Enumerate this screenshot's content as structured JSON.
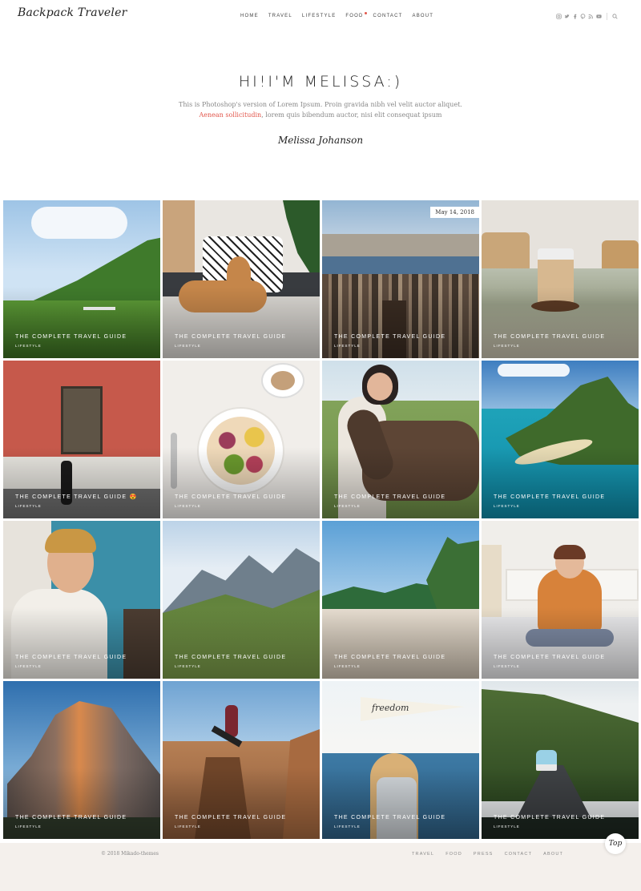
{
  "header": {
    "logo": "Backpack Traveler",
    "nav": [
      "HOME",
      "TRAVEL",
      "LIFESTYLE",
      "FOOD",
      "CONTACT",
      "ABOUT"
    ],
    "social_icons": [
      "instagram-icon",
      "twitter-icon",
      "facebook-icon",
      "pinterest-icon",
      "rss-icon",
      "youtube-icon"
    ],
    "search_icon": "search-icon"
  },
  "intro": {
    "title": "HI!I'M MELISSA:)",
    "line1": "This is Photoshop's version  of Lorem Ipsum. Proin gravida nibh vel velit auctor aliquet.",
    "line2_link": "Aenean sollicitudin",
    "line2_rest": ", lorem quis bibendum auctor, nisi elit consequat ipsum",
    "signature": "Melissa Johanson"
  },
  "posts": [
    {
      "title": "THE COMPLETE TRAVEL GUIDE",
      "category": "LIFESTYLE"
    },
    {
      "title": "THE COMPLETE TRAVEL GUIDE",
      "category": "LIFESTYLE"
    },
    {
      "title": "THE COMPLETE TRAVEL GUIDE",
      "category": "LIFESTYLE",
      "date": "May 14, 2018"
    },
    {
      "title": "THE COMPLETE TRAVEL GUIDE",
      "category": "LIFESTYLE"
    },
    {
      "title": "THE COMPLETE TRAVEL GUIDE 😍",
      "category": "LIFESTYLE"
    },
    {
      "title": "THE COMPLETE TRAVEL GUIDE",
      "category": "LIFESTYLE"
    },
    {
      "title": "THE COMPLETE TRAVEL GUIDE",
      "category": "LIFESTYLE"
    },
    {
      "title": "THE COMPLETE TRAVEL GUIDE",
      "category": "LIFESTYLE"
    },
    {
      "title": "THE COMPLETE TRAVEL GUIDE",
      "category": "LIFESTYLE"
    },
    {
      "title": "THE COMPLETE TRAVEL GUIDE",
      "category": "LIFESTYLE"
    },
    {
      "title": "THE COMPLETE TRAVEL GUIDE",
      "category": "LIFESTYLE"
    },
    {
      "title": "THE COMPLETE TRAVEL GUIDE",
      "category": "LIFESTYLE"
    },
    {
      "title": "THE COMPLETE TRAVEL GUIDE",
      "category": "LIFESTYLE"
    },
    {
      "title": "THE COMPLETE TRAVEL GUIDE",
      "category": "LIFESTYLE"
    },
    {
      "title": "THE COMPLETE TRAVEL GUIDE",
      "category": "LIFESTYLE"
    },
    {
      "title": "THE COMPLETE TRAVEL GUIDE",
      "category": "LIFESTYLE"
    }
  ],
  "flag_text": "freedom",
  "footer": {
    "copyright": "© 2018 Mikado-themes",
    "nav": [
      "TRAVEL",
      "FOOD",
      "PRESS",
      "CONTACT",
      "ABOUT"
    ],
    "top_label": "Top"
  },
  "colors": {
    "accent": "#e2574c",
    "footer_bg": "#f4f0ec"
  }
}
